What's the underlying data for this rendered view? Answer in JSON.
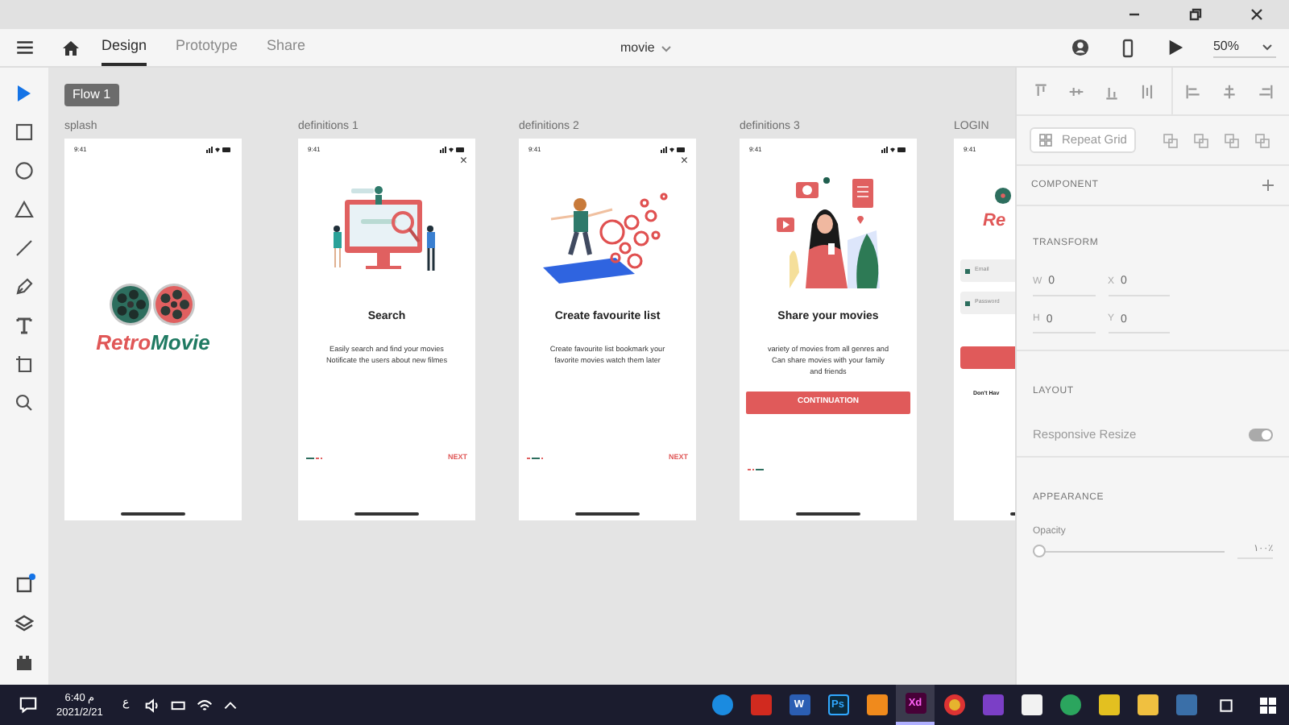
{
  "window": {
    "title": "movie"
  },
  "toolbar": {
    "tabs": [
      {
        "label": "Design",
        "selected": true
      },
      {
        "label": "Prototype",
        "selected": false
      },
      {
        "label": "Share",
        "selected": false
      }
    ],
    "zoom": "50%"
  },
  "tools": [
    {
      "kind": "select",
      "selected": true
    },
    {
      "kind": "rect",
      "selected": false
    },
    {
      "kind": "ellipse",
      "selected": false
    },
    {
      "kind": "triangle",
      "selected": false
    },
    {
      "kind": "line",
      "selected": false
    },
    {
      "kind": "pen",
      "selected": false
    },
    {
      "kind": "text",
      "selected": false
    },
    {
      "kind": "artboard",
      "selected": false
    },
    {
      "kind": "zoom",
      "selected": false
    }
  ],
  "canvas": {
    "flow_label": "Flow 1",
    "artboards": [
      {
        "kind": "splash",
        "name": "splash",
        "time": "9:41",
        "logo": [
          "Retro",
          "Movie"
        ]
      },
      {
        "kind": "onboarding",
        "art": {
          "kind": "search"
        },
        "name": "definitions 1",
        "time": "9:41",
        "close": "×",
        "title": "Search",
        "body": "Easily  search  and find  your movies\nNotificate the users about new filmes",
        "next": "NEXT",
        "dots": [
          {
            "selected": true
          },
          {
            "selected": false
          },
          {
            "selected": false
          }
        ]
      },
      {
        "kind": "onboarding",
        "art": {
          "kind": "favourite"
        },
        "name": "definitions 2",
        "time": "9:41",
        "close": "×",
        "title": "Create favourite list",
        "body": "Create favourite list bookmark your\nfavorite movies watch them later",
        "next": "NEXT",
        "dots": [
          {
            "selected": false
          },
          {
            "selected": true
          },
          {
            "selected": false
          }
        ]
      },
      {
        "kind": "onboarding",
        "art": {
          "kind": "share"
        },
        "name": "definitions 3",
        "time": "9:41",
        "title": "Share your movies",
        "body": "variety of movies from all genres and\nCan share movies with your family\nand friends",
        "button": "CONTINUATION",
        "dots": [
          {
            "selected": false
          },
          {
            "selected": false
          },
          {
            "selected": true
          }
        ]
      },
      {
        "kind": "login",
        "name": "LOGIN",
        "time": "9:41",
        "logo": "Re",
        "fields": [
          {
            "placeholder": "Email"
          },
          {
            "placeholder": "Password"
          }
        ],
        "footer": "Don't Hav"
      }
    ]
  },
  "panel": {
    "repeat_grid": "Repeat Grid",
    "component": "COMPONENT",
    "transform": {
      "title": "TRANSFORM",
      "fields": [
        {
          "label": "W",
          "value": "0"
        },
        {
          "label": "X",
          "value": "0"
        },
        {
          "label": "H",
          "value": "0"
        },
        {
          "label": "Y",
          "value": "0"
        }
      ]
    },
    "layout": {
      "title": "LAYOUT",
      "responsive_resize": "Responsive Resize",
      "on": true
    },
    "appearance": {
      "title": "APPEARANCE",
      "opacity": "Opacity",
      "level": 0,
      "value": "١٠٠٪"
    }
  },
  "taskbar": {
    "time": "6:40 م",
    "date": "2021/2/21",
    "language": "ع",
    "apps": [
      {
        "kind": "edge",
        "selected": false
      },
      {
        "kind": "pdf",
        "selected": false
      },
      {
        "kind": "word",
        "label": "W",
        "selected": false
      },
      {
        "kind": "ps",
        "label": "Ps",
        "selected": false
      },
      {
        "kind": "orange",
        "selected": false
      },
      {
        "kind": "xd",
        "label": "Xd",
        "selected": true
      },
      {
        "kind": "chrome",
        "selected": false
      },
      {
        "kind": "vs",
        "selected": false
      },
      {
        "kind": "store",
        "selected": false
      },
      {
        "kind": "maps",
        "selected": false
      },
      {
        "kind": "tool",
        "selected": false
      },
      {
        "kind": "folder",
        "selected": false
      },
      {
        "kind": "python",
        "selected": false
      }
    ]
  }
}
